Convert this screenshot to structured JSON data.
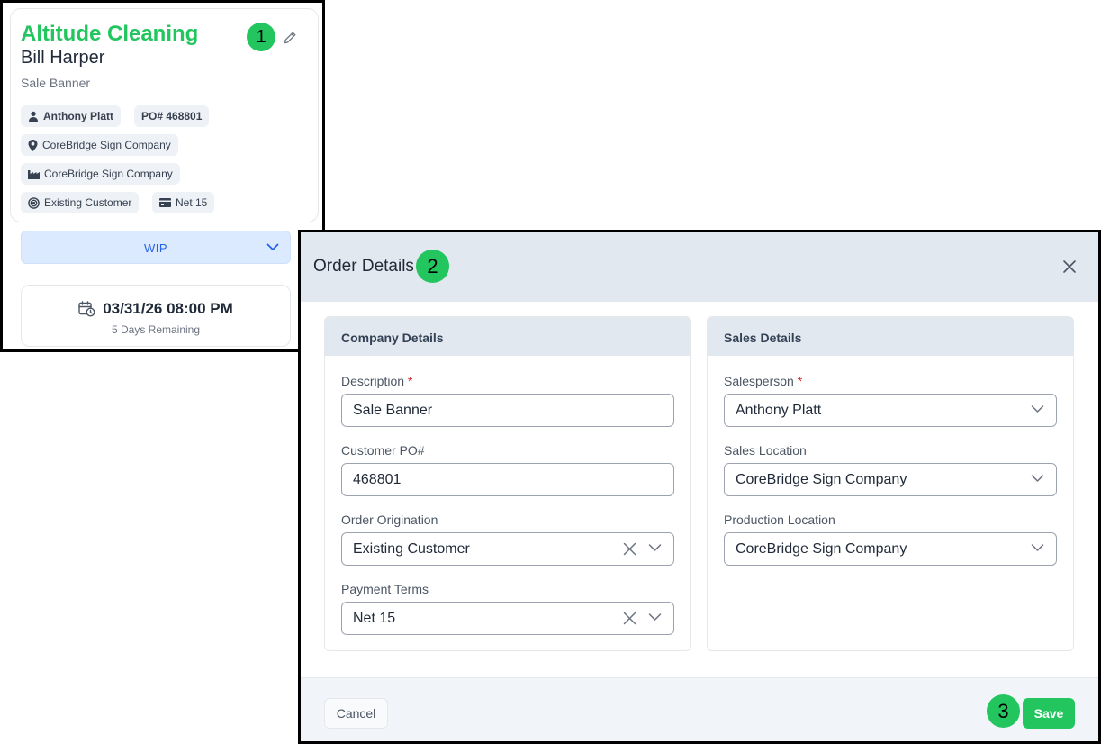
{
  "order_card": {
    "company_name": "Altitude Cleaning",
    "contact_name": "Bill Harper",
    "description": "Sale Banner",
    "step_badge": "1",
    "chips": {
      "salesperson": "Anthony Platt",
      "po": "PO# 468801",
      "sales_location": "CoreBridge Sign Company",
      "production_location": "CoreBridge Sign Company",
      "origination": "Existing Customer",
      "payment_terms": "Net 15"
    },
    "status": "WIP",
    "due_date": "03/31/26 08:00 PM",
    "days_remaining": "5 Days Remaining"
  },
  "modal": {
    "title": "Order Details",
    "step_badge": "2",
    "company_details": {
      "heading": "Company Details",
      "description_label": "Description",
      "description_value": "Sale Banner",
      "customer_po_label": "Customer PO#",
      "customer_po_value": "468801",
      "order_origination_label": "Order Origination",
      "order_origination_value": "Existing Customer",
      "payment_terms_label": "Payment Terms",
      "payment_terms_value": "Net 15"
    },
    "sales_details": {
      "heading": "Sales Details",
      "salesperson_label": "Salesperson",
      "salesperson_value": "Anthony Platt",
      "sales_location_label": "Sales Location",
      "sales_location_value": "CoreBridge Sign Company",
      "production_location_label": "Production Location",
      "production_location_value": "CoreBridge Sign Company"
    },
    "required_marker": "*",
    "footer": {
      "cancel_label": "Cancel",
      "save_label": "Save",
      "step_badge": "3"
    }
  },
  "colors": {
    "accent_green": "#22c55e",
    "status_blue_bg": "#dbeafe",
    "status_blue_text": "#2563eb",
    "header_gray": "#e2e8f0",
    "required_red": "#dc2626"
  },
  "icons": [
    "pencil-icon",
    "person-icon",
    "map-pin-icon",
    "factory-icon",
    "target-icon",
    "credit-card-icon",
    "chevron-down-icon",
    "calendar-clock-icon",
    "close-icon",
    "clear-icon"
  ]
}
